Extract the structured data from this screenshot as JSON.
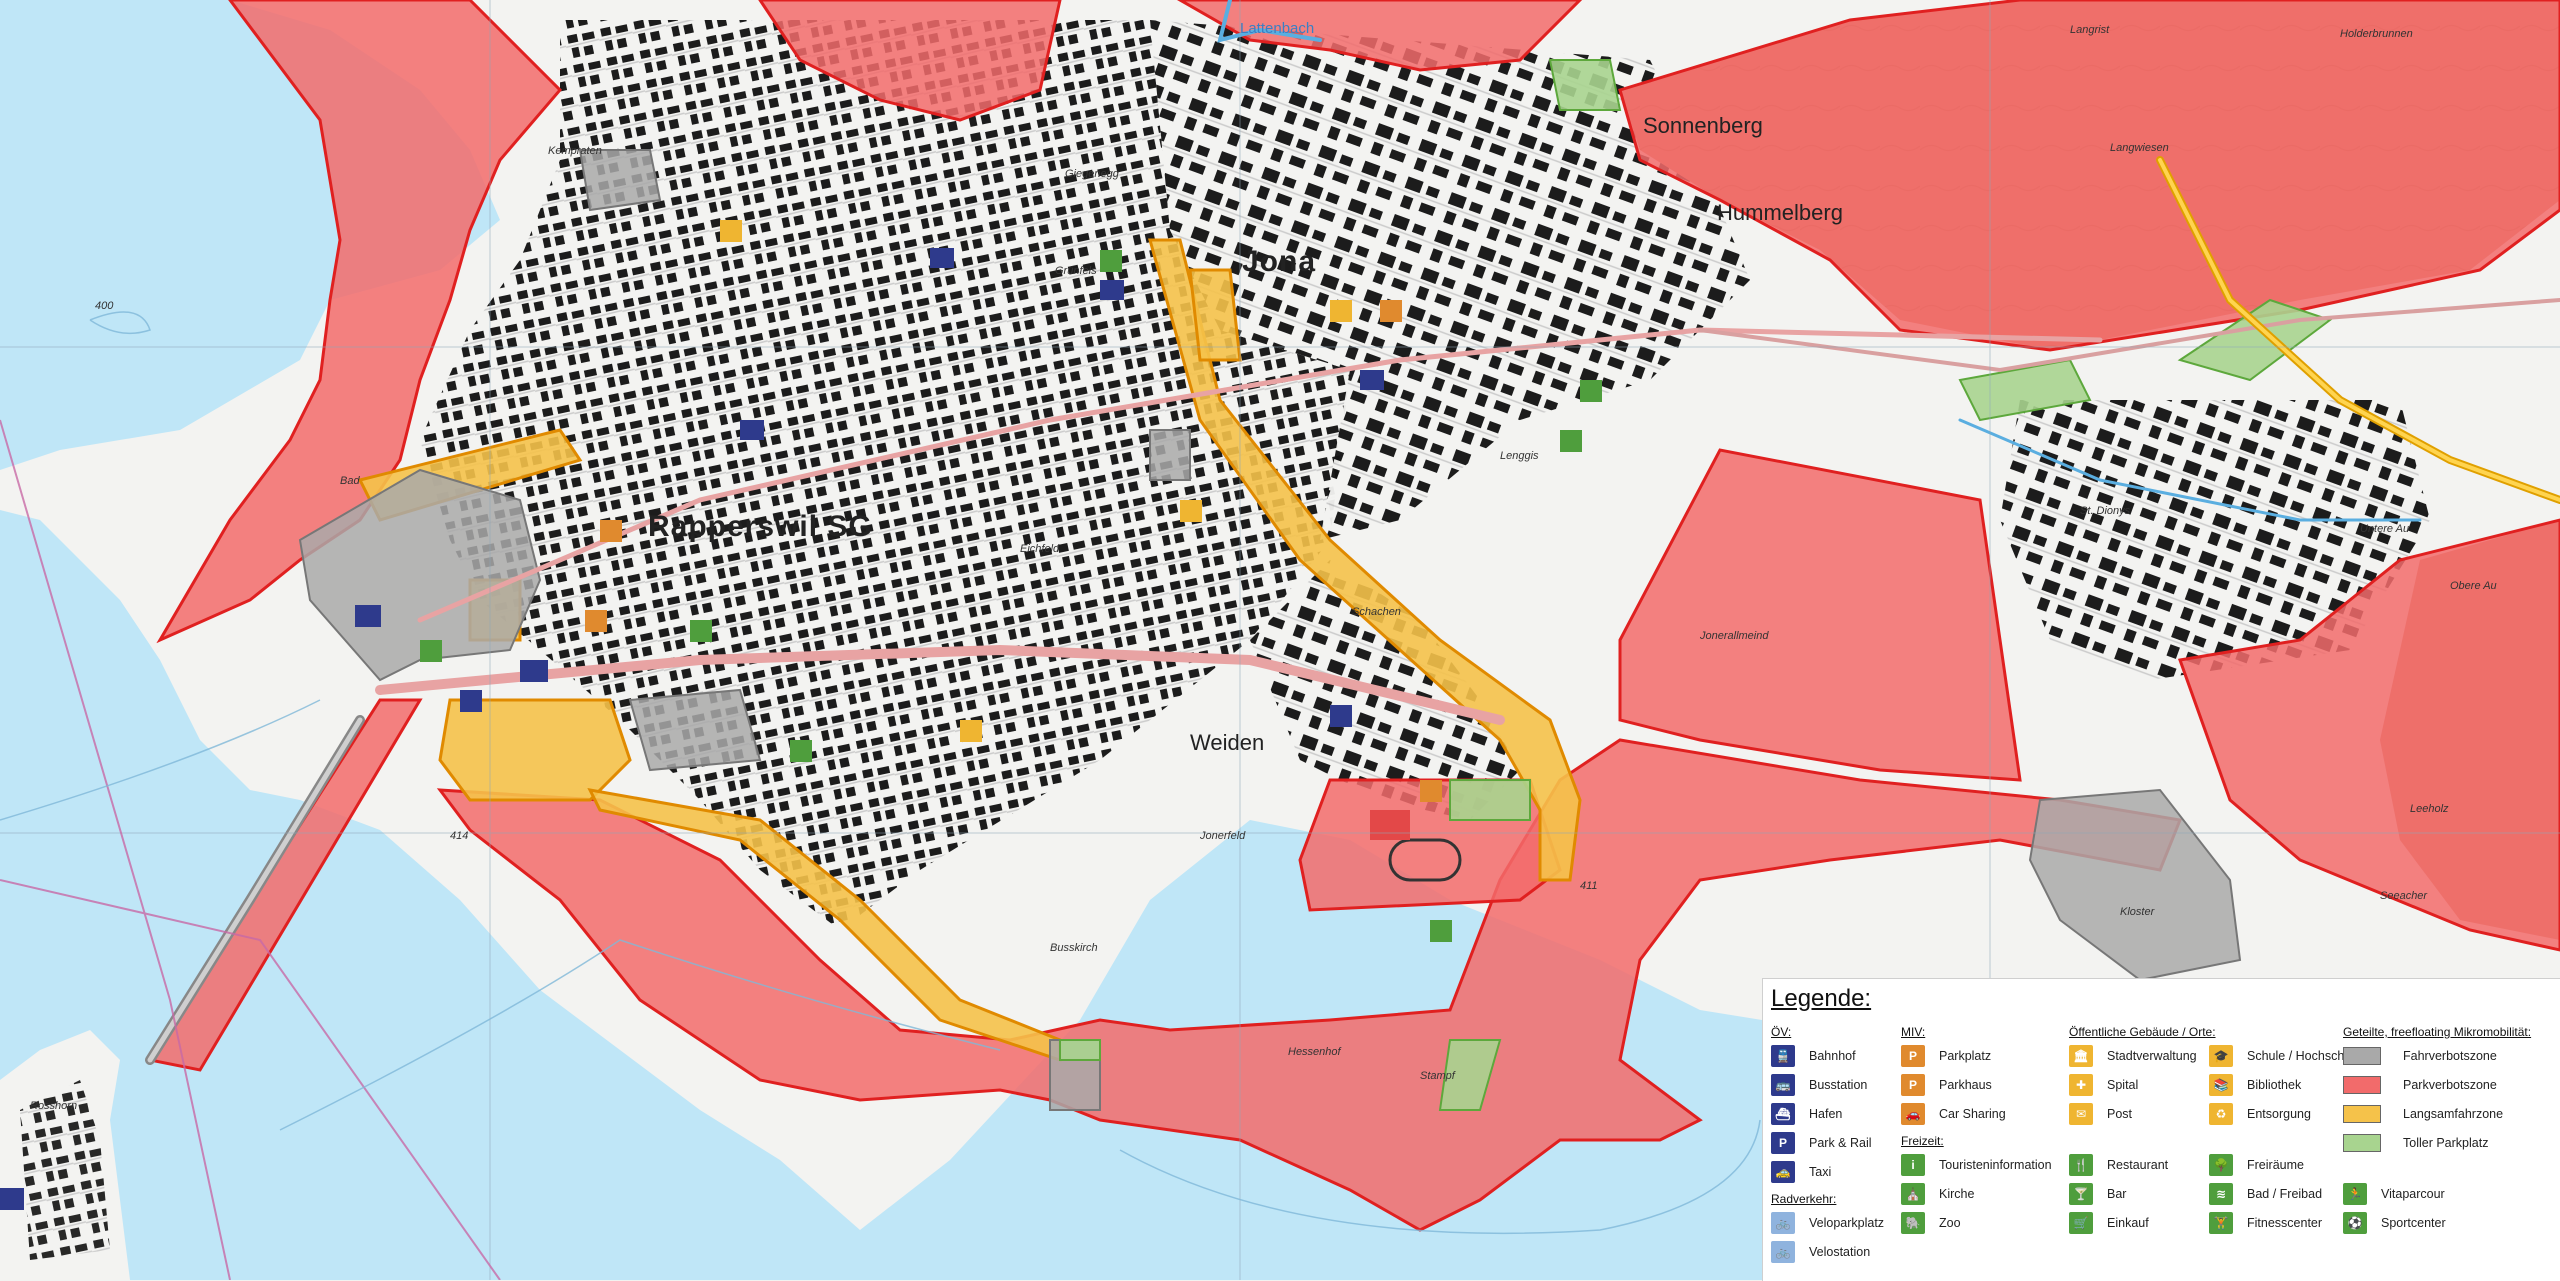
{
  "colors": {
    "water": "#bfe6f7",
    "land": "#f3f3f1",
    "fahrverbotszone": "#a9a9a9",
    "parkverbotszone": "#f26b6b",
    "langsamfahrzone": "#f5c24a",
    "toller_parkplatz": "#a8d48f",
    "forest": "#d07a55",
    "buildings": "#111111"
  },
  "map_labels": {
    "rapperswil": "Rapperswil SG",
    "jona": "Jona",
    "lattenbach": "Lattenbach",
    "sonnenberg": "Sonnenberg",
    "hummelberg": "Hummelberg",
    "schachen": "Schachen",
    "weiden": "Weiden",
    "jonerfeld": "Jonerfeld",
    "hessenhof": "Hessenhof",
    "rosshorn": "Rosshorn",
    "bad": "Bad",
    "giegenegg": "Giegenegg",
    "grunfels": "Grünfels",
    "eichfeld": "Eichfeld",
    "kempraten": "Kempraten",
    "lenggis": "Lenggis",
    "st_dionys": "St. Dionys",
    "langrist": "Langrist",
    "holderbrunnen": "Holderbrunnen",
    "langwiesen": "Langwiesen",
    "untere_au": "Untere Au",
    "obere_au": "Obere Au",
    "leeholz": "Leeholz",
    "seewiese": "Seewiese",
    "jonerallmeind": "Jonerallmeind",
    "kloster": "Kloster",
    "busskirch": "Busskirch",
    "stampf": "Stampf",
    "seeacher": "Seeacher",
    "elevation_400": "400",
    "elevation_414": "414",
    "road_411": "411"
  },
  "legend": {
    "title": "Legende:",
    "sections": [
      {
        "heading": "ÖV:",
        "items": [
          {
            "label": "Bahnhof",
            "icon": "train-icon",
            "glyph": "🚆",
            "color": "blue"
          },
          {
            "label": "Busstation",
            "icon": "bus-icon",
            "glyph": "🚌",
            "color": "blue"
          },
          {
            "label": "Hafen",
            "icon": "ship-icon",
            "glyph": "⛴",
            "color": "blue"
          },
          {
            "label": "Park & Rail",
            "icon": "park-rail-icon",
            "glyph": "P",
            "color": "blue"
          },
          {
            "label": "Taxi",
            "icon": "taxi-icon",
            "glyph": "🚕",
            "color": "blue"
          }
        ]
      },
      {
        "heading": "Radverkehr:",
        "items": [
          {
            "label": "Veloparkplatz",
            "icon": "bike-parking-icon",
            "glyph": "🚲",
            "color": "lblue"
          },
          {
            "label": "Velostation",
            "icon": "bike-station-icon",
            "glyph": "🚲",
            "color": "lblue"
          }
        ]
      },
      {
        "heading": "MIV:",
        "items": [
          {
            "label": "Parkplatz",
            "icon": "parking-icon",
            "glyph": "P",
            "color": "orange"
          },
          {
            "label": "Parkhaus",
            "icon": "parking-garage-icon",
            "glyph": "P",
            "color": "orange"
          },
          {
            "label": "Car Sharing",
            "icon": "car-sharing-icon",
            "glyph": "🚗",
            "color": "orange"
          }
        ]
      },
      {
        "heading": "Freizeit:",
        "items": [
          {
            "label": "Touristeninformation",
            "icon": "info-icon",
            "glyph": "i",
            "color": "green"
          },
          {
            "label": "Kirche",
            "icon": "church-icon",
            "glyph": "⛪",
            "color": "green"
          },
          {
            "label": "Zoo",
            "icon": "elephant-icon",
            "glyph": "🐘",
            "color": "green"
          }
        ]
      },
      {
        "heading": "Öffentliche Gebäude / Orte:",
        "items": [
          {
            "label": "Stadtverwaltung",
            "icon": "town-hall-icon",
            "glyph": "🏛",
            "color": "yellow"
          },
          {
            "label": "Spital",
            "icon": "hospital-icon",
            "glyph": "✚",
            "color": "yellow"
          },
          {
            "label": "Post",
            "icon": "post-icon",
            "glyph": "✉",
            "color": "yellow"
          }
        ]
      },
      {
        "heading": "",
        "items": [
          {
            "label": "Restaurant",
            "icon": "restaurant-icon",
            "glyph": "🍴",
            "color": "green"
          },
          {
            "label": "Bar",
            "icon": "bar-icon",
            "glyph": "🍸",
            "color": "green"
          },
          {
            "label": "Einkauf",
            "icon": "shopping-icon",
            "glyph": "🛒",
            "color": "green"
          }
        ]
      },
      {
        "heading": "",
        "items": [
          {
            "label": "Schule / Hochschule",
            "icon": "school-icon",
            "glyph": "🎓",
            "color": "yellow"
          },
          {
            "label": "Bibliothek",
            "icon": "library-icon",
            "glyph": "📚",
            "color": "yellow"
          },
          {
            "label": "Entsorgung",
            "icon": "recycling-icon",
            "glyph": "♻",
            "color": "yellow"
          }
        ]
      },
      {
        "heading": "",
        "items": [
          {
            "label": "Freiräume",
            "icon": "tree-icon",
            "glyph": "🌳",
            "color": "green"
          },
          {
            "label": "Bad / Freibad",
            "icon": "pool-icon",
            "glyph": "≋",
            "color": "green"
          },
          {
            "label": "Fitnesscenter",
            "icon": "fitness-icon",
            "glyph": "🏋",
            "color": "green"
          }
        ]
      },
      {
        "heading": "",
        "items": [
          {
            "label": "Vitaparcour",
            "icon": "runner-icon",
            "glyph": "🏃",
            "color": "green"
          },
          {
            "label": "Sportcenter",
            "icon": "sport-icon",
            "glyph": "⚽",
            "color": "green"
          }
        ]
      },
      {
        "heading": "Geteilte, freefloating Mikromobilität:",
        "items": [
          {
            "label": "Fahrverbotszone",
            "swatch": "#a9a9a9"
          },
          {
            "label": "Parkverbotszone",
            "swatch": "#f26b6b"
          },
          {
            "label": "Langsamfahrzone",
            "swatch": "#f5c24a"
          },
          {
            "label": "Toller Parkplatz",
            "swatch": "#a8d48f"
          }
        ]
      }
    ]
  }
}
